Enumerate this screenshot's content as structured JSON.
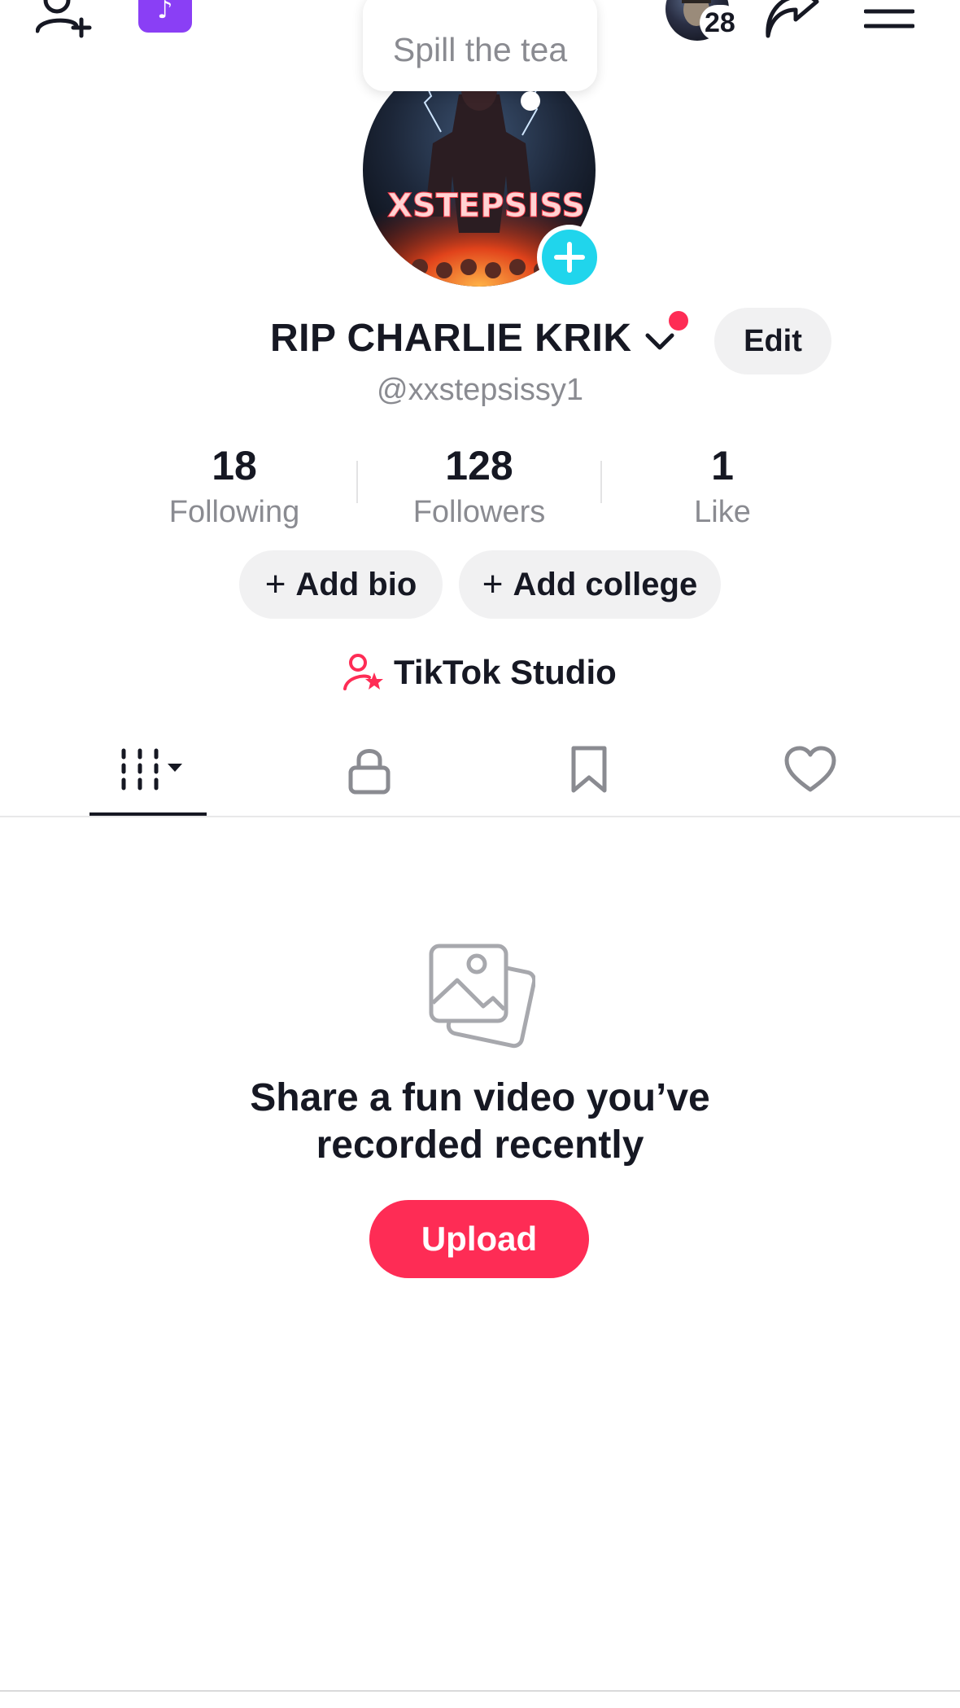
{
  "top_bar": {
    "add_friend_icon": "person-plus-icon",
    "app_badge_icon": "tiktok-note-icon",
    "story_count": "28",
    "share_icon": "share-arrow-icon",
    "menu_icon": "hamburger-menu-icon"
  },
  "bubble": {
    "text": "Spill the tea"
  },
  "profile": {
    "display_name": "RIP CHARLIE KRIK",
    "handle": "@xxstepsissy1",
    "edit_label": "Edit",
    "avatar_text": "XSTEPSISS"
  },
  "stats": [
    {
      "value": "18",
      "label": "Following"
    },
    {
      "value": "128",
      "label": "Followers"
    },
    {
      "value": "1",
      "label": "Like"
    }
  ],
  "actions": {
    "add_bio": "Add bio",
    "add_college": "Add college",
    "plus": "+"
  },
  "studio": {
    "label": "TikTok Studio"
  },
  "tabs": [
    {
      "icon": "grid-videos-icon",
      "active": true
    },
    {
      "icon": "lock-icon",
      "active": false
    },
    {
      "icon": "bookmark-icon",
      "active": false
    },
    {
      "icon": "heart-icon",
      "active": false
    }
  ],
  "empty_state": {
    "line1": "Share a fun video you’ve",
    "line2": "recorded recently",
    "upload_label": "Upload"
  },
  "colors": {
    "accent_red": "#fe2c55",
    "cyan": "#20d5ec",
    "purple": "#8a3ff5",
    "muted_text": "#8a8b91",
    "pill_bg": "#f1f1f2"
  }
}
